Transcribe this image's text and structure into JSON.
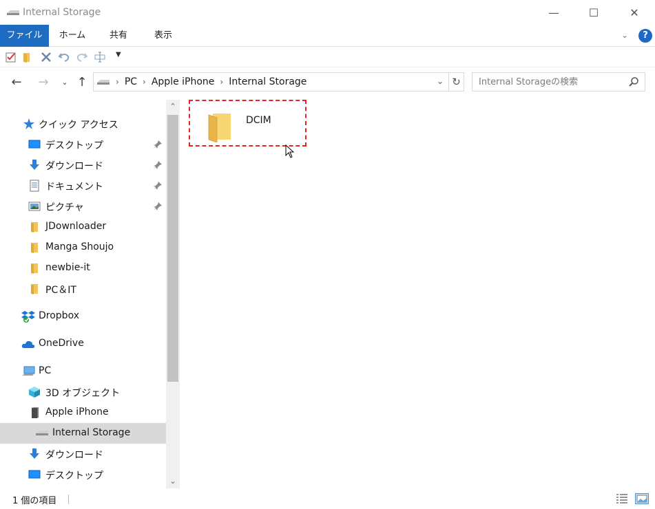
{
  "window": {
    "title": "Internal Storage",
    "minimize": "—",
    "maximize": "☐",
    "close": "✕"
  },
  "ribbon": {
    "tabs": [
      "ファイル",
      "ホーム",
      "共有",
      "表示"
    ],
    "help": "?"
  },
  "address": {
    "crumbs": [
      "PC",
      "Apple iPhone",
      "Internal Storage"
    ],
    "search_placeholder": "Internal Storageの検索"
  },
  "nav": {
    "quick_access": "クイック アクセス",
    "quick_items": [
      {
        "label": "デスクトップ",
        "icon": "desktop-icon",
        "pinned": true
      },
      {
        "label": "ダウンロード",
        "icon": "download-arrow-icon",
        "pinned": true
      },
      {
        "label": "ドキュメント",
        "icon": "document-icon",
        "pinned": true
      },
      {
        "label": "ピクチャ",
        "icon": "picture-icon",
        "pinned": true
      },
      {
        "label": "JDownloader",
        "icon": "folder-icon",
        "pinned": false
      },
      {
        "label": "Manga Shoujo",
        "icon": "folder-icon",
        "pinned": false
      },
      {
        "label": "newbie-it",
        "icon": "folder-icon",
        "pinned": false
      },
      {
        "label": "PC＆IT",
        "icon": "folder-icon",
        "pinned": false
      }
    ],
    "dropbox": "Dropbox",
    "onedrive": "OneDrive",
    "pc": "PC",
    "pc_items": [
      {
        "label": "3D オブジェクト",
        "icon": "3d-objects-icon"
      },
      {
        "label": "Apple iPhone",
        "icon": "phone-icon"
      },
      {
        "label": "Internal Storage",
        "icon": "drive-icon",
        "selected": true
      },
      {
        "label": "ダウンロード",
        "icon": "download-arrow-icon"
      },
      {
        "label": "デスクトップ",
        "icon": "desktop-icon"
      }
    ]
  },
  "content": {
    "items": [
      {
        "name": "DCIM",
        "icon": "folder-icon"
      }
    ]
  },
  "status": {
    "count": "1 個の項目"
  },
  "colors": {
    "accent": "#1e6cc1",
    "selection_outline": "#e8231f",
    "folder": "#f2c55c"
  }
}
